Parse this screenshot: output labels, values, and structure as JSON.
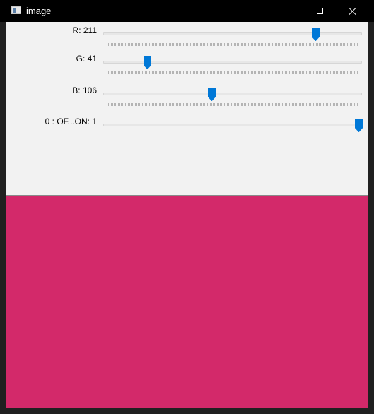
{
  "window": {
    "title": "image",
    "icon": "app-window-icon"
  },
  "controls": {
    "minimize_icon": "minimize-icon",
    "maximize_icon": "maximize-icon",
    "close_icon": "close-icon"
  },
  "trackbars": [
    {
      "label": "R: 211",
      "value": 211,
      "max": 255
    },
    {
      "label": "G: 41",
      "value": 41,
      "max": 255
    },
    {
      "label": "B: 106",
      "value": 106,
      "max": 255
    },
    {
      "label": "0 : OF...ON: 1",
      "value": 1,
      "max": 1
    }
  ],
  "colors": {
    "thumb": "#0078d7",
    "preview": "#d3296a"
  }
}
